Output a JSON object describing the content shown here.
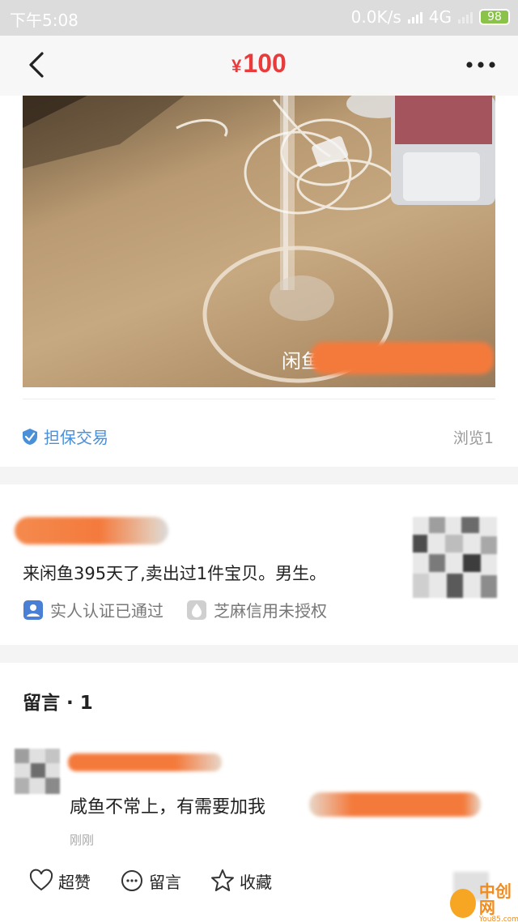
{
  "status_bar": {
    "time": "下午5:08",
    "network_speed": "0.0K/s",
    "network_type": "4G",
    "battery": "98"
  },
  "nav": {
    "currency_symbol": "¥",
    "price": "100",
    "price_color": "#e93b3b"
  },
  "product": {
    "watermark_text": "闲鱼",
    "guarantee_label": "担保交易",
    "views_label": "浏览1"
  },
  "seller": {
    "description": "来闲鱼395天了,卖出过1件宝贝。男生。",
    "real_name_badge": "实人认证已通过",
    "zhima_badge": "芝麻信用未授权"
  },
  "comments": {
    "title": "留言 · 1",
    "items": [
      {
        "text": "咸鱼不常上，有需要加我",
        "time": "刚刚"
      }
    ],
    "actions": {
      "like": "超赞",
      "comment": "留言",
      "favorite": "收藏"
    }
  },
  "site_logo": {
    "name": "中创网",
    "domain": "You85.com"
  },
  "colors": {
    "accent_blue": "#4a90d9",
    "redaction_orange": "#f47a3c"
  }
}
